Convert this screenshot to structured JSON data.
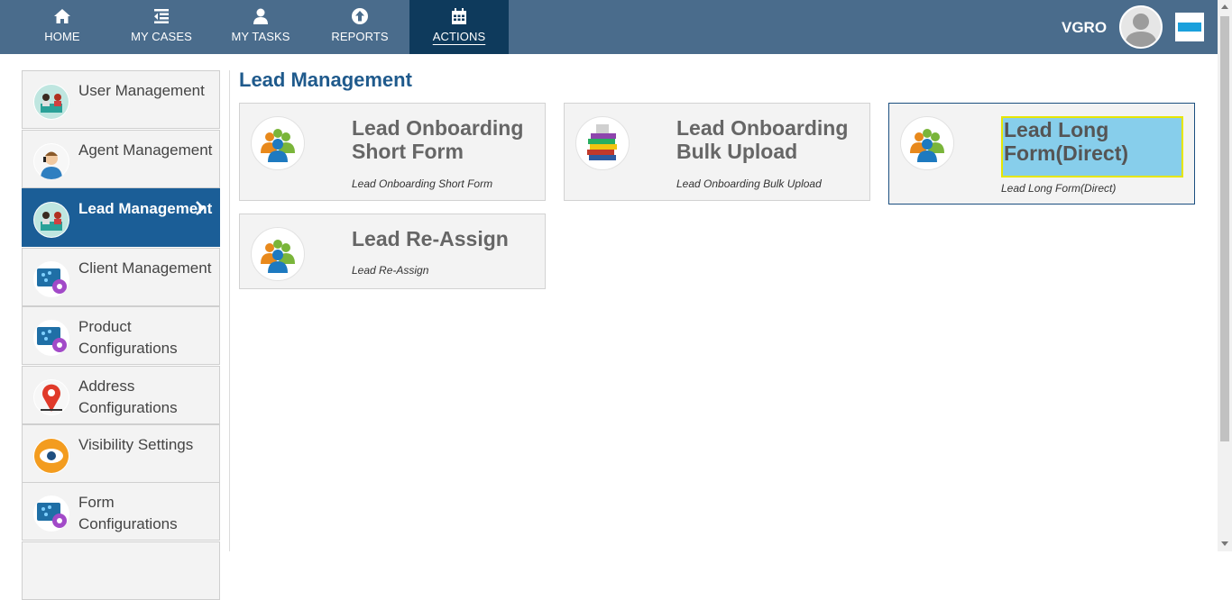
{
  "nav": {
    "items": [
      {
        "label": "HOME",
        "icon": "home-icon"
      },
      {
        "label": "MY CASES",
        "icon": "cases-list-icon"
      },
      {
        "label": "MY TASKS",
        "icon": "user-icon"
      },
      {
        "label": "REPORTS",
        "icon": "arrow-up-circle-icon"
      },
      {
        "label": "ACTIONS",
        "icon": "calendar-icon",
        "active": true
      }
    ],
    "user_name": "VGRO",
    "colors": {
      "bar": "#4a6c8c",
      "active": "#0e3a5c"
    }
  },
  "sidebar": {
    "items": [
      {
        "label": "User Management",
        "icon": "office-people-icon"
      },
      {
        "label": "Agent Management",
        "icon": "agent-headset-icon"
      },
      {
        "label": "Lead Management",
        "icon": "office-people-icon",
        "active": true
      },
      {
        "label": "Client Management",
        "icon": "monitor-gear-icon"
      },
      {
        "label": "Product Configurations",
        "icon": "monitor-gear-icon"
      },
      {
        "label": "Address Configurations",
        "icon": "map-pin-icon"
      },
      {
        "label": "Visibility Settings",
        "icon": "eye-icon"
      },
      {
        "label": "Form Configurations",
        "icon": "monitor-gear-icon"
      }
    ],
    "active_color": "#1b5e97"
  },
  "main": {
    "title": "Lead Management",
    "cards": [
      {
        "title": "Lead Onboarding Short Form",
        "subtitle": "Lead Onboarding Short Form",
        "icon": "people-group-icon"
      },
      {
        "title": "Lead Onboarding Bulk Upload",
        "subtitle": "Lead Onboarding Bulk Upload",
        "icon": "document-stack-icon"
      },
      {
        "title": "Lead Long Form(Direct)",
        "subtitle": "Lead Long Form(Direct)",
        "icon": "people-group-icon",
        "selected": true
      },
      {
        "title": "Lead Re-Assign",
        "subtitle": "Lead Re-Assign",
        "icon": "people-group-icon"
      }
    ]
  }
}
